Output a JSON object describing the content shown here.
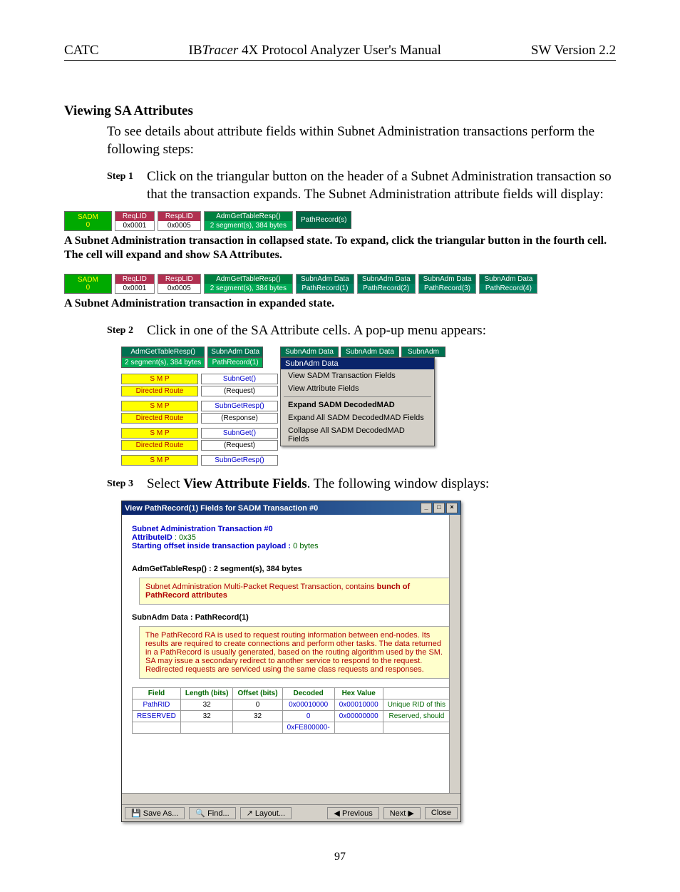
{
  "header": {
    "left": "CATC",
    "center_prefix": "IB",
    "center_italic": "Tracer",
    "center_suffix": " 4X Protocol Analyzer User's Manual",
    "right": "SW Version 2.2"
  },
  "section_title": "Viewing SA Attributes",
  "intro": "To see details about attribute fields within Subnet Administration transactions perform the following steps:",
  "step1_label": "Step 1",
  "step1_text": "Click on the triangular button on the header of a Subnet Administration transaction so that the transaction expands.  The Subnet Administration attribute fields will display:",
  "ss1": {
    "sadm_top": "SADM",
    "sadm_bot": "0",
    "reqlid_top": "ReqLID",
    "reqlid_bot": "0x0001",
    "resplid_top": "RespLID",
    "resplid_bot": "0x0005",
    "adm_top": "AdmGetTableResp()",
    "adm_bot": "2 segment(s), 384 bytes",
    "path": "PathRecord(s)"
  },
  "caption1": "A Subnet Administration transaction in collapsed state.  To expand, click the triangular button in the fourth cell.  The cell will expand and show SA Attributes.",
  "ss1b": {
    "subn_top": "SubnAdm Data",
    "pr1": "PathRecord(1)",
    "pr2": "PathRecord(2)",
    "pr3": "PathRecord(3)",
    "pr4": "PathRecord(4)"
  },
  "caption2": "A Subnet Administration transaction in expanded state.",
  "step2_label": "Step 2",
  "step2_text": "Click in one of the SA Attribute cells.  A pop-up menu appears:",
  "ss2": {
    "adm_top": "AdmGetTableResp()",
    "adm_bot": "2 segment(s), 384 bytes",
    "subn_top": "SubnAdm Data",
    "pr1": "PathRecord(1)",
    "subn2": "SubnAdm Data",
    "subn3": "SubnAdm Data",
    "subn4": "SubnAdm",
    "menu_title": "SubnAdm Data",
    "smp": "S M P",
    "directed": "Directed Route",
    "subnget": "SubnGet()",
    "request": "(Request)",
    "subngetresp": "SubnGetResp()",
    "response": "(Response)",
    "menu": {
      "m1": "View SADM Transaction Fields",
      "m2": "View Attribute Fields",
      "m3": "Expand SADM DecodedMAD",
      "m4": "Expand All SADM DecodedMAD Fields",
      "m5": "Collapse All SADM DecodedMAD Fields"
    }
  },
  "step3_label": "Step 3",
  "step3_text_a": "Select ",
  "step3_text_b": "View Attribute Fields",
  "step3_text_c": ". The following window displays:",
  "ss3": {
    "title": "View PathRecord(1) Fields for SADM Transaction #0",
    "line1": "Subnet Administration Transaction #0",
    "line2a": "AttributeID",
    "line2b": " : 0x35",
    "line3a": "Starting offset inside transaction payload :",
    "line3b": " 0 bytes",
    "line4": "AdmGetTableResp() : 2 segment(s), 384 bytes",
    "box1a": "Subnet Administration Multi-Packet Request Transaction, contains ",
    "box1b": "bunch of PathRecord attributes",
    "line5": "SubnAdm Data : PathRecord(1)",
    "box2": "The PathRecord RA is used to request routing information between end-nodes. Its results are required to create connections and perform other tasks. The data returned in a PathRecord is usually generated, based on the routing algorithm used by the SM. SA may issue a secondary redirect to another service to respond to the request. Redirected requests are serviced using the same class requests and responses.",
    "tbl": {
      "h1": "Field",
      "h2": "Length (bits)",
      "h3": "Offset (bits)",
      "h4": "Decoded",
      "h5": "Hex Value",
      "h6": "",
      "r1": {
        "c1": "PathRID",
        "c2": "32",
        "c3": "0",
        "c4": "0x00010000",
        "c5": "0x00010000",
        "c6": "Unique RID of this"
      },
      "r2": {
        "c1": "RESERVED",
        "c2": "32",
        "c3": "32",
        "c4": "0",
        "c5": "0x00000000",
        "c6": "Reserved, should"
      },
      "r3": {
        "c4": "0xFE800000-"
      }
    },
    "btns": {
      "saveas": "Save As...",
      "find": "Find...",
      "layout": "Layout...",
      "previous": "Previous",
      "next": "Next",
      "close": "Close"
    }
  },
  "page_num": "97"
}
